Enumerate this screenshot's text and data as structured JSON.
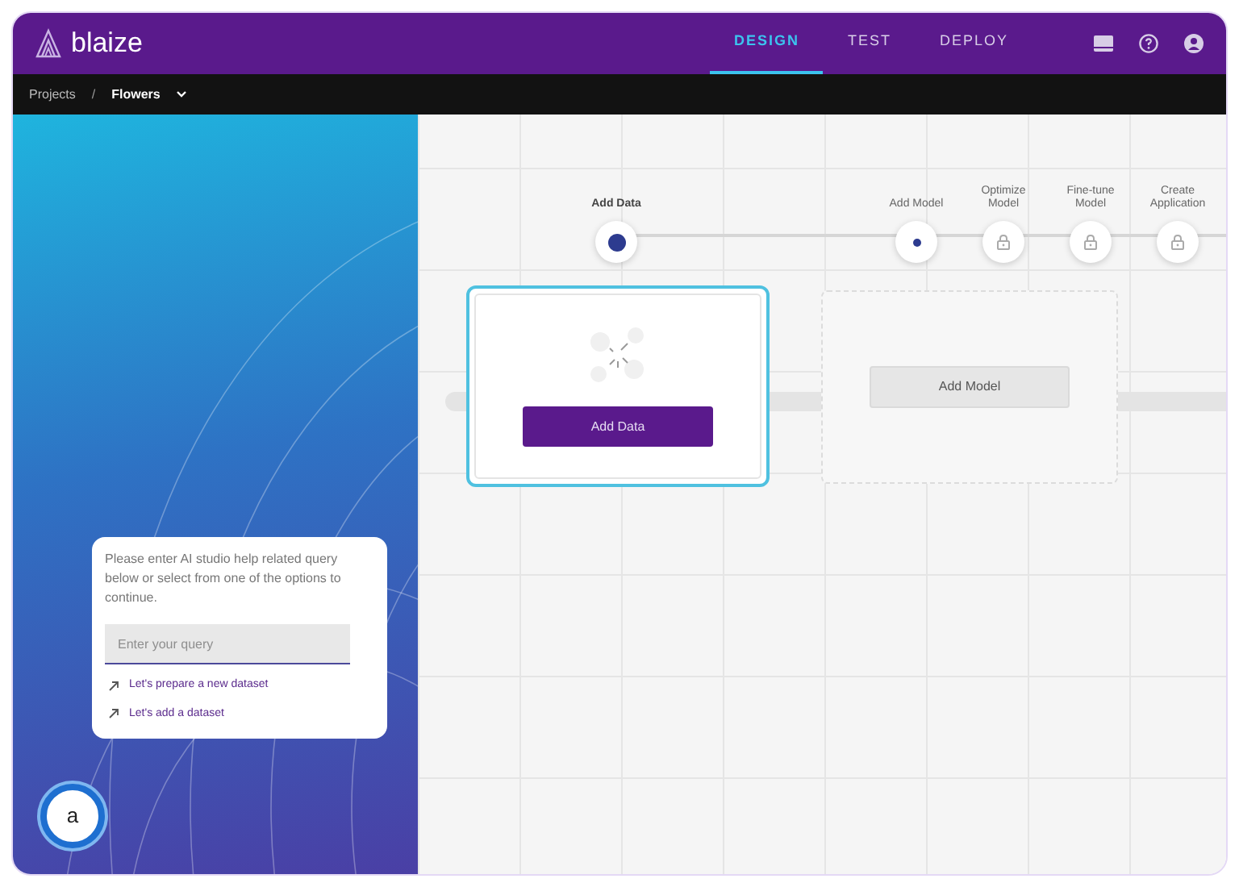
{
  "header": {
    "logo": "blaize",
    "tabs": [
      {
        "label": "DESIGN",
        "selected": true
      },
      {
        "label": "TEST",
        "selected": false
      },
      {
        "label": "DEPLOY",
        "selected": false
      }
    ]
  },
  "breadcrumb": {
    "items": [
      "Projects",
      "Flowers"
    ],
    "separator": "/"
  },
  "steps": [
    {
      "label": "Add Data",
      "current": true,
      "locked": false
    },
    {
      "label": "Add Model",
      "current": false,
      "locked": false
    },
    {
      "label": "Optimize Model",
      "current": false,
      "locked": true
    },
    {
      "label": "Fine-tune Model",
      "current": false,
      "locked": true
    },
    {
      "label": "Create Application",
      "current": false,
      "locked": true
    }
  ],
  "cards": [
    {
      "button": "Add Data",
      "selected": true
    },
    {
      "button": "Add Model",
      "selected": false
    }
  ],
  "assistant": {
    "message": "Please enter AI studio help related query below or select from one of the options to continue.",
    "placeholder": "Enter your query",
    "suggestions": [
      "Let's prepare a new dataset",
      "Let's add a dataset"
    ],
    "bot_label": "a"
  }
}
